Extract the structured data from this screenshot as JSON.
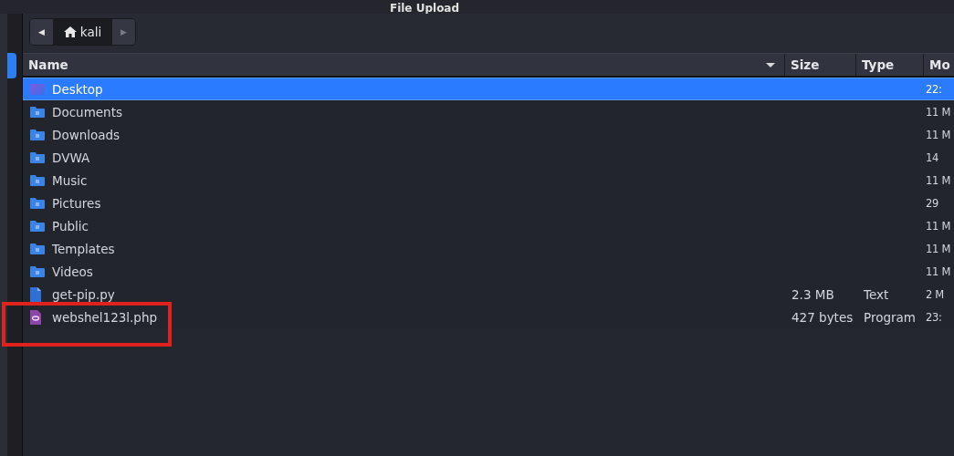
{
  "window": {
    "title": "File Upload"
  },
  "path_bar": {
    "back": "◀",
    "location": "kali",
    "forward": "▶"
  },
  "columns": [
    {
      "label": "Name",
      "sorted": true
    },
    {
      "label": "Size",
      "sorted": false
    },
    {
      "label": "Type",
      "sorted": false
    },
    {
      "label": "Mo",
      "sorted": false
    }
  ],
  "rows": [
    {
      "name": "Desktop",
      "kind": "desktop",
      "size": "",
      "type": "",
      "modified": "22:",
      "selected": true
    },
    {
      "name": "Documents",
      "kind": "folder",
      "size": "",
      "type": "",
      "modified": "11 M",
      "selected": false
    },
    {
      "name": "Downloads",
      "kind": "folder",
      "size": "",
      "type": "",
      "modified": "11 M",
      "selected": false
    },
    {
      "name": "DVWA",
      "kind": "folder",
      "size": "",
      "type": "",
      "modified": "14",
      "selected": false
    },
    {
      "name": "Music",
      "kind": "folder",
      "size": "",
      "type": "",
      "modified": "11 M",
      "selected": false
    },
    {
      "name": "Pictures",
      "kind": "folder",
      "size": "",
      "type": "",
      "modified": "29",
      "selected": false
    },
    {
      "name": "Public",
      "kind": "folder",
      "size": "",
      "type": "",
      "modified": "11 M",
      "selected": false
    },
    {
      "name": "Templates",
      "kind": "folder",
      "size": "",
      "type": "",
      "modified": "11 M",
      "selected": false
    },
    {
      "name": "Videos",
      "kind": "folder",
      "size": "",
      "type": "",
      "modified": "11 M",
      "selected": false
    },
    {
      "name": "get-pip.py",
      "kind": "text",
      "size": "2.3 MB",
      "type": "Text",
      "modified": "2 M",
      "selected": false
    },
    {
      "name": "webshel123l.php",
      "kind": "program",
      "size": "427 bytes",
      "type": "Program",
      "modified": "23:",
      "selected": false
    }
  ],
  "annotation": {
    "kind": "highlight-box"
  }
}
